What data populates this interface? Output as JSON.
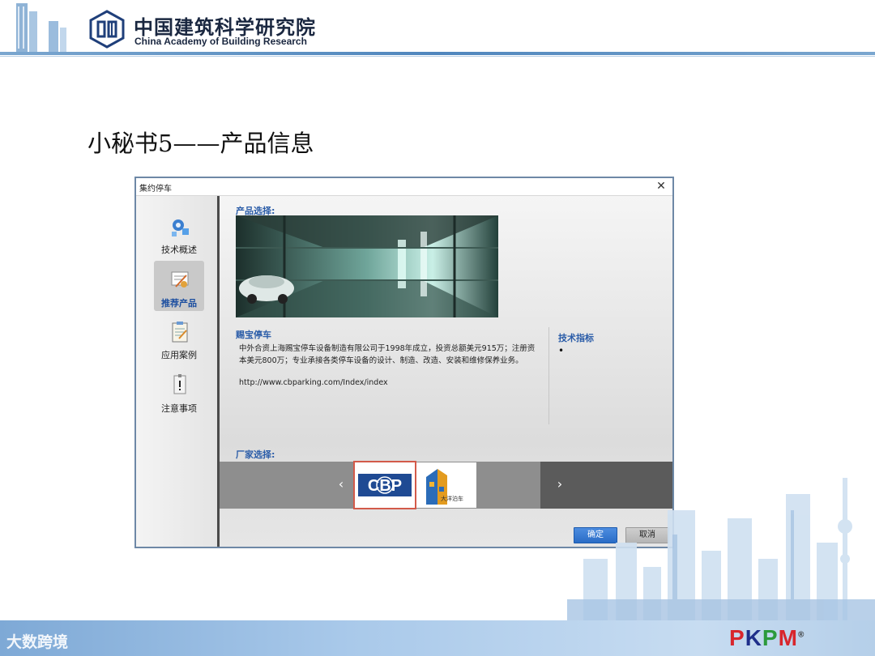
{
  "header": {
    "org_name_cn": "中国建筑科学研究院",
    "org_name_en": "China Academy of Building Research",
    "logo_icon": "cabr-logo-icon"
  },
  "slide": {
    "title": "小秘书5——产品信息"
  },
  "dialog": {
    "title": "集约停车",
    "close_label": "✕",
    "sidebar": {
      "items": [
        {
          "label": "技术概述",
          "icon": "gear-cubes-icon",
          "active": false
        },
        {
          "label": "推荐产品",
          "icon": "certificate-icon",
          "active": true
        },
        {
          "label": "应用案例",
          "icon": "clipboard-icon",
          "active": false
        },
        {
          "label": "注意事项",
          "icon": "warning-note-icon",
          "active": false
        }
      ]
    },
    "content": {
      "product_select_label": "产品选择:",
      "product_name": "赐宝停车",
      "product_desc": "中外合资上海赐宝停车设备制造有限公司于1998年成立，投资总额美元915万；注册资本美元800万；专业承接各类停车设备的设计、制造、改造、安装和维修保养业务。",
      "product_url": "http://www.cbparking.com/Index/index",
      "tech_label": "技术指标",
      "tech_bullet": "•",
      "manufacturer_label": "厂家选择:",
      "prev_arrow": "‹",
      "next_arrow": "›",
      "manufacturers": [
        {
          "name": "CBP",
          "selected": true
        },
        {
          "name": "大洋泊车",
          "sub": "DAYANG PARKING",
          "selected": false
        }
      ]
    },
    "buttons": {
      "ok": "确定",
      "cancel": "取消"
    }
  },
  "footer": {
    "watermark": "大数跨境",
    "brand_p": "P",
    "brand_k": "K",
    "brand_d": "P",
    "brand_m": "M",
    "brand_reg": "®"
  }
}
